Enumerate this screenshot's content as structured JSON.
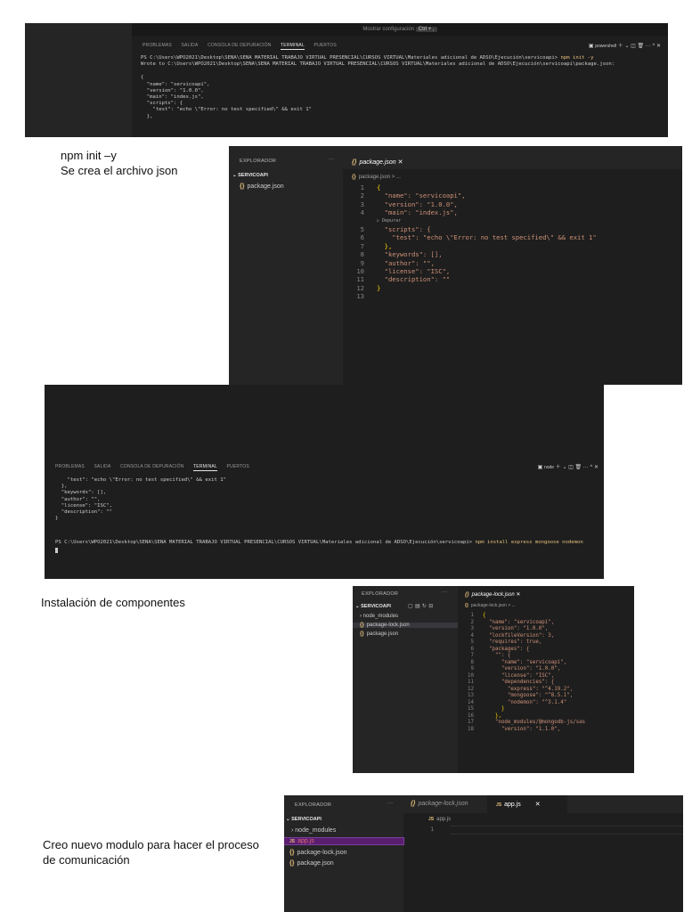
{
  "shot1": {
    "command_center": "Mostrar configuración",
    "command_center_key": "Ctrl + ,",
    "panel_tabs": [
      "PROBLEMAS",
      "SALIDA",
      "CONSOLA DE DEPURACIÓN",
      "TERMINAL",
      "PUERTOS"
    ],
    "shell": "powershell",
    "prompt": "PS C:\\Users\\WPO2021\\Desktop\\SENA\\SENA MATERIAL TRABAJO VIRTUAL PRESENCIAL\\CURSOS VIRTUAL\\Materiales adicional de ADSO\\Ejecución\\servicoapi>",
    "command": "npm init -y",
    "wrote": "Wrote to C:\\Users\\WPO2021\\Desktop\\SENA\\SENA MATERIAL TRABAJO VIRTUAL PRESENCIAL\\CURSOS VIRTUAL\\Materiales adicional de ADSO\\Ejecución\\servicoapi\\package.json:",
    "output_lines": [
      "{",
      "  \"name\": \"servicoapi\",",
      "  \"version\": \"1.0.0\",",
      "  \"main\": \"index.js\",",
      "  \"scripts\": {",
      "    \"test\": \"echo \\\"Error: no test specified\\\" && exit 1\"",
      "  },"
    ]
  },
  "caption1": {
    "line1": "npm init –y",
    "line2": "Se crea el archivo json"
  },
  "shot2": {
    "explorer_title": "EXPLORADOR",
    "more": "···",
    "folder": "SERVICOAPI",
    "files": [
      "package.json"
    ],
    "tab": "package.json",
    "tab_close": "✕",
    "breadcrumb": "package.json > ...",
    "codelens": "Depurar",
    "code": [
      "{",
      "  \"name\": \"servicoapi\",",
      "  \"version\": \"1.0.0\",",
      "  \"main\": \"index.js\",",
      "  \"scripts\": {",
      "    \"test\": \"echo \\\"Error: no test specified\\\" && exit 1\"",
      "  },",
      "  \"keywords\": [],",
      "  \"author\": \"\",",
      "  \"license\": \"ISC\",",
      "  \"description\": \"\"",
      "}",
      ""
    ]
  },
  "shot3": {
    "panel_tabs": [
      "PROBLEMAS",
      "SALIDA",
      "CONSOLA DE DEPURACIÓN",
      "TERMINAL",
      "PUERTOS"
    ],
    "shell": "node",
    "output_lines": [
      "    \"test\": \"echo \\\"Error: no test specified\\\" && exit 1\"",
      "  },",
      "  \"keywords\": [],",
      "  \"author\": \"\",",
      "  \"license\": \"ISC\",",
      "  \"description\": \"\"",
      "}"
    ],
    "prompt": "PS C:\\Users\\WPO2021\\Desktop\\SENA\\SENA MATERIAL TRABAJO VIRTUAL PRESENCIAL\\CURSOS VIRTUAL\\Materiales adicional de ADSO\\Ejecución\\servicoapi>",
    "command": "npm install express mongoose nodemon"
  },
  "caption2": {
    "line1": "Instalación de componentes"
  },
  "shot4": {
    "explorer_title": "EXPLORADOR",
    "more": "···",
    "folder": "SERVICOAPI",
    "files": [
      "node_modules",
      "package-lock.json",
      "package.json"
    ],
    "tab": "package-lock.json",
    "tab_close": "✕",
    "breadcrumb": "package-lock.json > ...",
    "code": [
      "{",
      "  \"name\": \"servicoapi\",",
      "  \"version\": \"1.0.0\",",
      "  \"lockfileVersion\": 3,",
      "  \"requires\": true,",
      "  \"packages\": {",
      "    \"\": {",
      "      \"name\": \"servicoapi\",",
      "      \"version\": \"1.0.0\",",
      "      \"license\": \"ISC\",",
      "      \"dependencies\": {",
      "        \"express\": \"^4.19.2\",",
      "        \"mongoose\": \"^8.5.1\",",
      "        \"nodemon\": \"^3.1.4\"",
      "      }",
      "    },",
      "    \"node_modules/@mongodb-js/sas",
      "      \"version\": \"1.1.0\","
    ]
  },
  "caption3": {
    "line1": "Creo nuevo modulo para hacer el proceso",
    "line2": "de comunicación"
  },
  "shot5": {
    "explorer_title": "EXPLORADOR",
    "more": "···",
    "folder": "SERVICOAPI",
    "files": [
      "node_modules",
      "app.js",
      "package-lock.json",
      "package.json"
    ],
    "tabs": [
      "package-lock.json",
      "app.js"
    ],
    "tab_close": "✕",
    "breadcrumb": "app.js",
    "line1": "1"
  }
}
